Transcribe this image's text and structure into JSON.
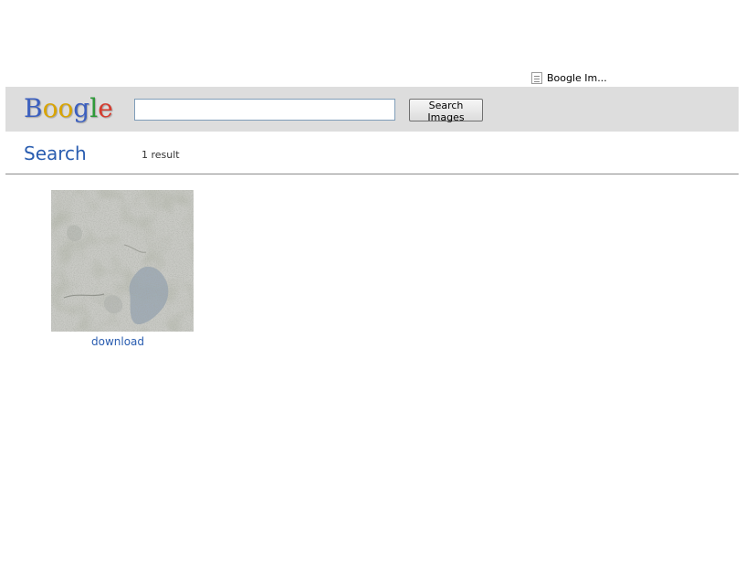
{
  "tab": {
    "label": "Boogle Im...",
    "icon": "page-icon"
  },
  "search_bar": {
    "logo": {
      "letters": [
        "B",
        "o",
        "o",
        "g",
        "l",
        "e"
      ],
      "colors": [
        "#3b5fbf",
        "#d9a400",
        "#d9a400",
        "#3b5fbf",
        "#2f9a3a",
        "#d63b2e"
      ]
    },
    "input_value": "",
    "button_label": "Search Images",
    "background": "#dddddd"
  },
  "results": {
    "title": "Search",
    "count_text": "1 result",
    "accent": "#2a5db0",
    "items": [
      {
        "link_text": "download",
        "image": "concrete-wall-texture"
      }
    ]
  }
}
